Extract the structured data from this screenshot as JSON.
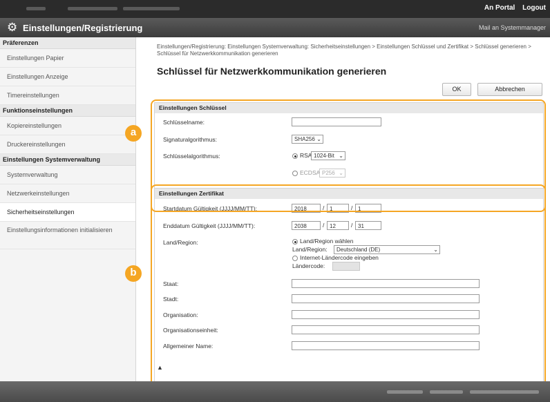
{
  "header": {
    "portal_link": "An Portal",
    "logout_link": "Logout",
    "title": "Einstellungen/Registrierung",
    "mail_link": "Mail an Systemmanager"
  },
  "sidebar": {
    "groups": [
      {
        "heading": "Präferenzen",
        "items": [
          "Einstellungen Papier",
          "Einstellungen Anzeige",
          "Timereinstellungen"
        ]
      },
      {
        "heading": "Funktionseinstellungen",
        "items": [
          "Kopiereinstellungen",
          "Druckereinstellungen"
        ]
      },
      {
        "heading": "Einstellungen Systemverwaltung",
        "items": [
          "Systemverwaltung",
          "Netzwerkeinstellungen",
          "Sicherheitseinstellungen",
          "Einstellungsinformationen initialisieren"
        ]
      }
    ]
  },
  "breadcrumb": "Einstellungen/Registrierung: Einstellungen Systemverwaltung: Sicherheitseinstellungen > Einstellungen Schlüssel und Zertifikat > Schlüssel generieren > Schlüssel für Netzwerkkommunikation generieren",
  "page_title": "Schlüssel für Netzwerkkommunikation generieren",
  "buttons": {
    "ok": "OK",
    "cancel": "Abbrechen"
  },
  "key_section": {
    "heading": "Einstellungen Schlüssel",
    "key_name_label": "Schlüsselname:",
    "key_name_value": "",
    "sig_label": "Signaturalgorithmus:",
    "sig_value": "SHA256",
    "key_alg_label": "Schlüsselalgorithmus:",
    "rsa_label": "RSA",
    "rsa_value": "1024-Bit",
    "ecdsa_label": "ECDSA",
    "ecdsa_value": "P256"
  },
  "cert_section": {
    "heading": "Einstellungen Zertifikat",
    "start_label": "Startdatum Gültigkeit (JJJJ/MM/TT):",
    "start": {
      "year": "2018",
      "month": "1",
      "day": "1"
    },
    "end_label": "Enddatum Gültigkeit (JJJJ/MM/TT):",
    "end": {
      "year": "2038",
      "month": "12",
      "day": "31"
    },
    "region_label": "Land/Region:",
    "region_choose": "Land/Region wählen",
    "region_sub_label": "Land/Region:",
    "region_value": "Deutschland (DE)",
    "internet_code_label": "Internet-Ländercode eingeben",
    "country_code_label": "Ländercode:",
    "country_code_value": "",
    "state_label": "Staat:",
    "city_label": "Stadt:",
    "org_label": "Organisation:",
    "unit_label": "Organisationseinheit:",
    "common_name_label": "Allgemeiner Name:",
    "state_value": "",
    "city_value": "",
    "org_value": "",
    "unit_value": "",
    "common_name_value": ""
  },
  "markers": {
    "a": "a",
    "b": "b"
  },
  "to_top": "▲",
  "colors": {
    "highlight": "#f5a623",
    "titlebar": "#4a4a4a"
  }
}
